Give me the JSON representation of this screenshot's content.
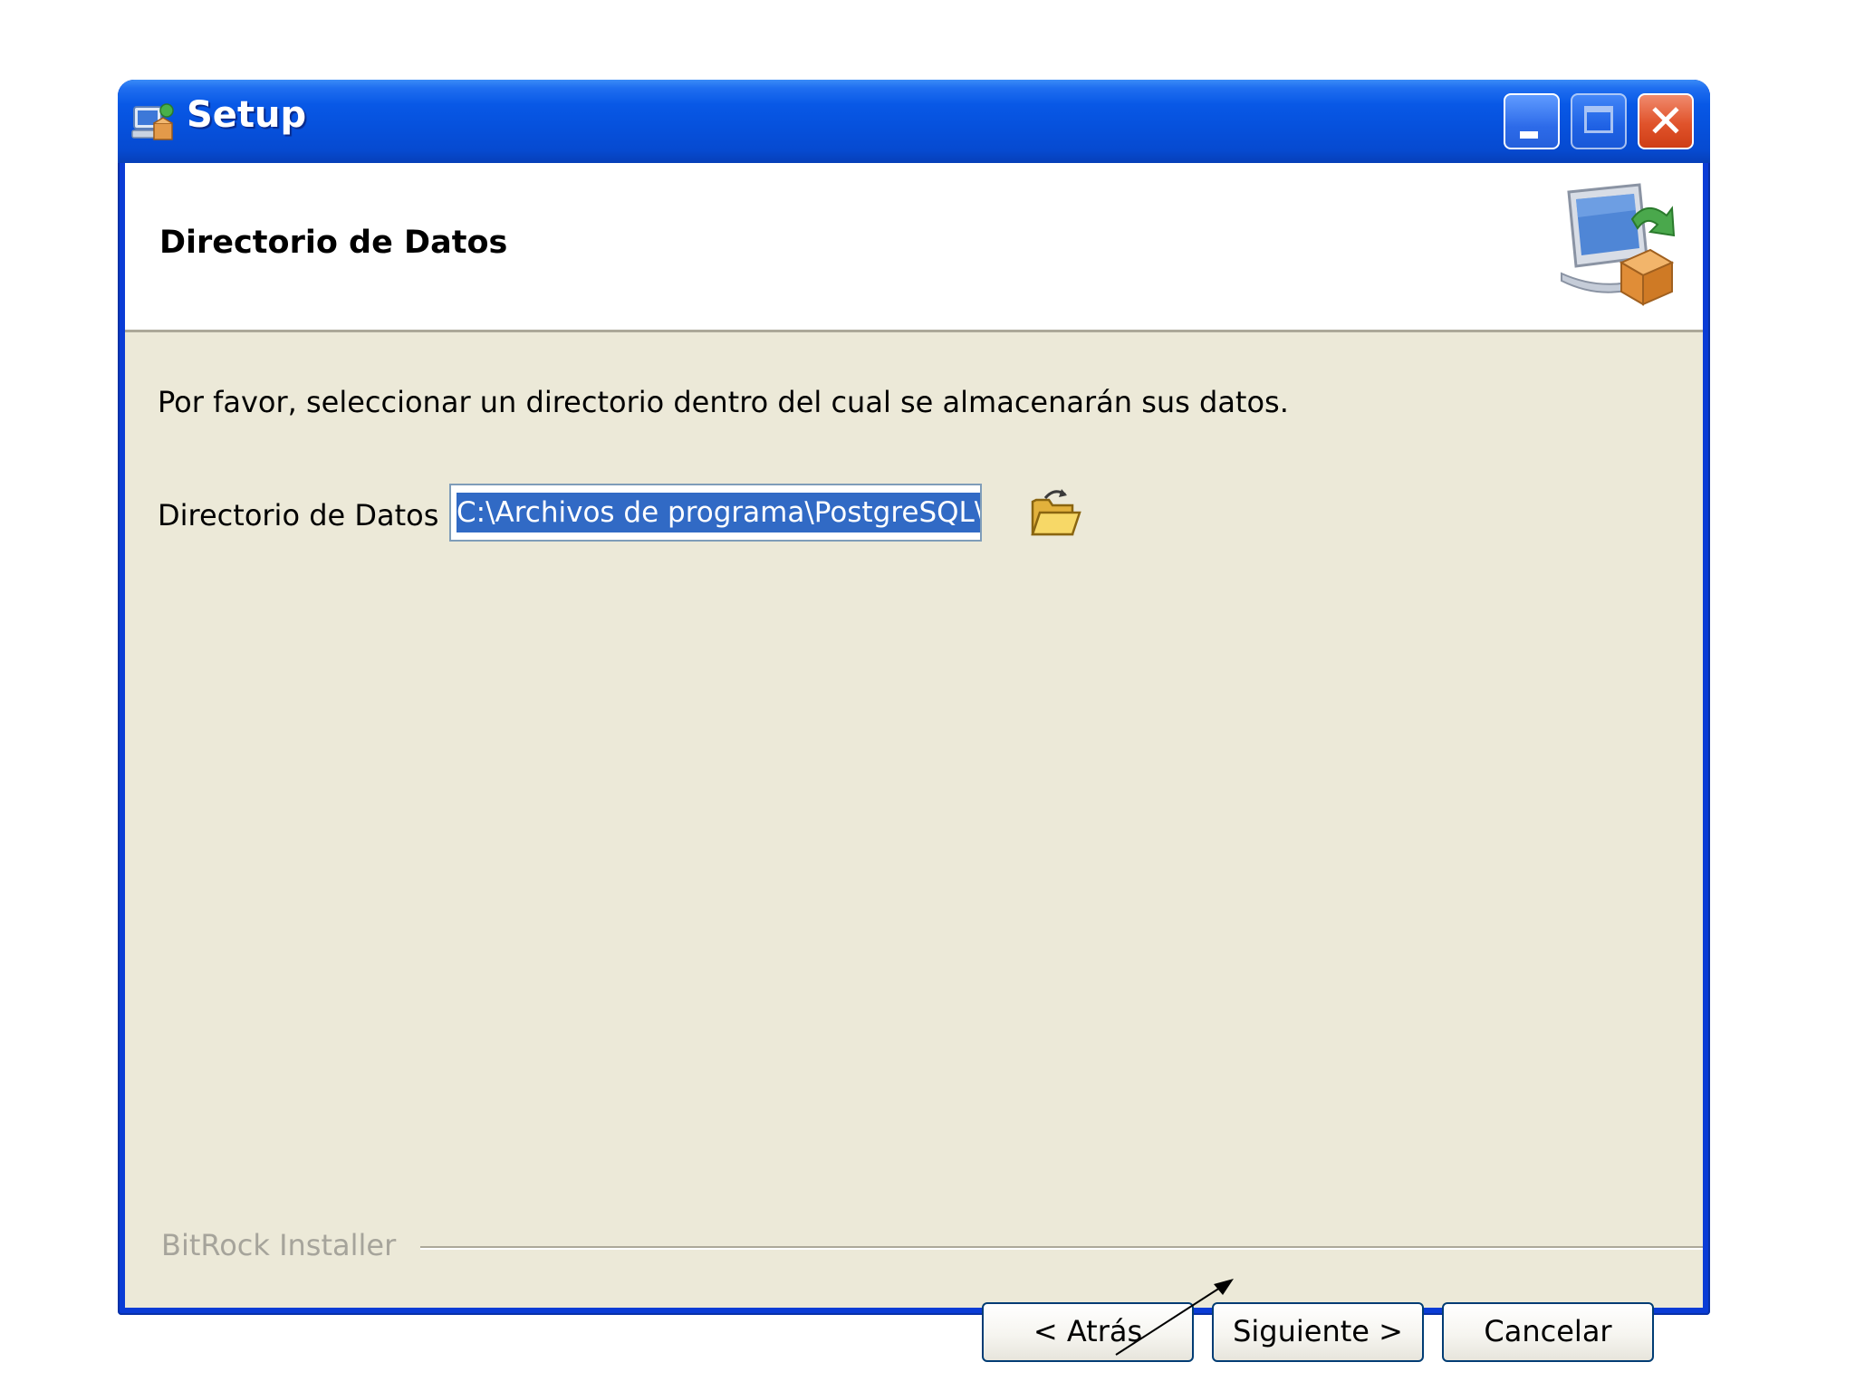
{
  "window": {
    "title": "Setup",
    "minimize_label": "_",
    "maximize_label": "□",
    "close_label": "✕"
  },
  "header": {
    "title": "Directorio de Datos"
  },
  "body": {
    "instruction": "Por favor, seleccionar un directorio dentro del cual se almacenarán sus datos.",
    "field_label": "Directorio de Datos",
    "field_value": "C:\\Archivos de programa\\PostgreSQL\\"
  },
  "footer": {
    "brand": "BitRock Installer",
    "back_label": "< Atrás",
    "next_label": "Siguiente >",
    "cancel_label": "Cancelar"
  },
  "colors": {
    "titlebar": "#0a3cd6",
    "client_bg": "#ece9d8",
    "selection": "#316ac5"
  },
  "icons": {
    "app": "installer-icon",
    "header": "computer-package-icon",
    "browse": "open-folder-icon"
  }
}
